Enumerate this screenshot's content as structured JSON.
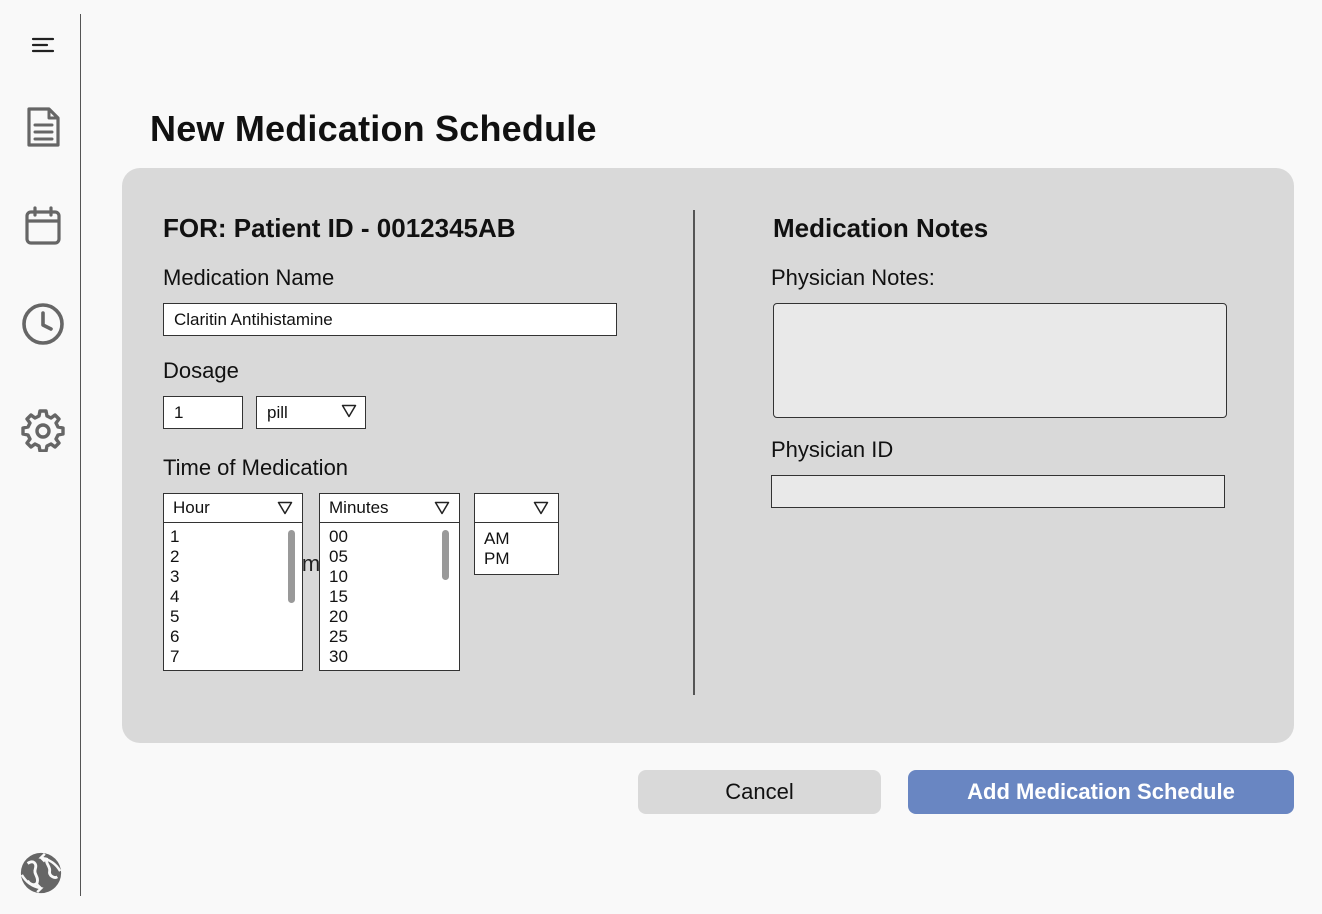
{
  "sidebar": {
    "icons": [
      "menu-icon",
      "document-icon",
      "calendar-icon",
      "clock-icon",
      "gear-icon",
      "sync-globe-icon"
    ]
  },
  "page": {
    "title": "New Medication Schedule"
  },
  "form": {
    "patient_heading": "FOR: Patient ID - 0012345AB",
    "medication_name_label": "Medication Name",
    "medication_name_value": "Claritin Antihistamine",
    "dosage_label": "Dosage",
    "dosage_amount": "1",
    "dosage_unit": "pill",
    "time_label": "Time of Medication",
    "ghost_text": "im",
    "hour": {
      "header": "Hour",
      "options": [
        "1",
        "2",
        "3",
        "4",
        "5",
        "6",
        "7"
      ]
    },
    "minutes": {
      "header": "Minutes",
      "options": [
        "00",
        "05",
        "10",
        "15",
        "20",
        "25",
        "30"
      ]
    },
    "ampm": {
      "header": "",
      "options": [
        "AM",
        "PM"
      ]
    }
  },
  "notes": {
    "heading": "Medication Notes",
    "physician_notes_label": "Physician Notes:",
    "physician_notes_value": "",
    "physician_id_label": "Physician ID",
    "physician_id_value": ""
  },
  "actions": {
    "cancel_label": "Cancel",
    "submit_label": "Add Medication Schedule"
  },
  "colors": {
    "background": "#f9f9f9",
    "panel": "#d9d9d9",
    "primary": "#6986c2",
    "field_grey": "#e9e9e9"
  }
}
